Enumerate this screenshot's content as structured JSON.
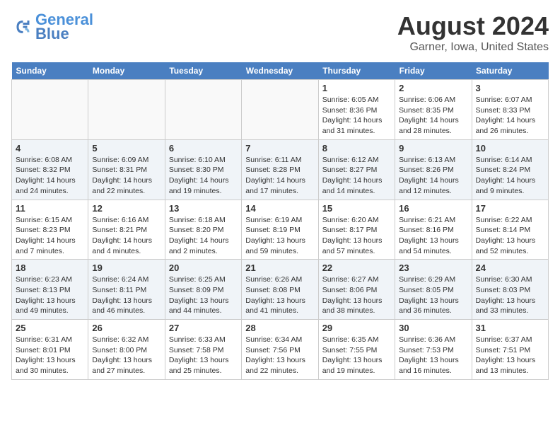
{
  "header": {
    "logo_line1": "General",
    "logo_line2": "Blue",
    "main_title": "August 2024",
    "subtitle": "Garner, Iowa, United States"
  },
  "calendar": {
    "days_of_week": [
      "Sunday",
      "Monday",
      "Tuesday",
      "Wednesday",
      "Thursday",
      "Friday",
      "Saturday"
    ],
    "weeks": [
      [
        {
          "day": "",
          "info": ""
        },
        {
          "day": "",
          "info": ""
        },
        {
          "day": "",
          "info": ""
        },
        {
          "day": "",
          "info": ""
        },
        {
          "day": "1",
          "info": "Sunrise: 6:05 AM\nSunset: 8:36 PM\nDaylight: 14 hours\nand 31 minutes."
        },
        {
          "day": "2",
          "info": "Sunrise: 6:06 AM\nSunset: 8:35 PM\nDaylight: 14 hours\nand 28 minutes."
        },
        {
          "day": "3",
          "info": "Sunrise: 6:07 AM\nSunset: 8:33 PM\nDaylight: 14 hours\nand 26 minutes."
        }
      ],
      [
        {
          "day": "4",
          "info": "Sunrise: 6:08 AM\nSunset: 8:32 PM\nDaylight: 14 hours\nand 24 minutes."
        },
        {
          "day": "5",
          "info": "Sunrise: 6:09 AM\nSunset: 8:31 PM\nDaylight: 14 hours\nand 22 minutes."
        },
        {
          "day": "6",
          "info": "Sunrise: 6:10 AM\nSunset: 8:30 PM\nDaylight: 14 hours\nand 19 minutes."
        },
        {
          "day": "7",
          "info": "Sunrise: 6:11 AM\nSunset: 8:28 PM\nDaylight: 14 hours\nand 17 minutes."
        },
        {
          "day": "8",
          "info": "Sunrise: 6:12 AM\nSunset: 8:27 PM\nDaylight: 14 hours\nand 14 minutes."
        },
        {
          "day": "9",
          "info": "Sunrise: 6:13 AM\nSunset: 8:26 PM\nDaylight: 14 hours\nand 12 minutes."
        },
        {
          "day": "10",
          "info": "Sunrise: 6:14 AM\nSunset: 8:24 PM\nDaylight: 14 hours\nand 9 minutes."
        }
      ],
      [
        {
          "day": "11",
          "info": "Sunrise: 6:15 AM\nSunset: 8:23 PM\nDaylight: 14 hours\nand 7 minutes."
        },
        {
          "day": "12",
          "info": "Sunrise: 6:16 AM\nSunset: 8:21 PM\nDaylight: 14 hours\nand 4 minutes."
        },
        {
          "day": "13",
          "info": "Sunrise: 6:18 AM\nSunset: 8:20 PM\nDaylight: 14 hours\nand 2 minutes."
        },
        {
          "day": "14",
          "info": "Sunrise: 6:19 AM\nSunset: 8:19 PM\nDaylight: 13 hours\nand 59 minutes."
        },
        {
          "day": "15",
          "info": "Sunrise: 6:20 AM\nSunset: 8:17 PM\nDaylight: 13 hours\nand 57 minutes."
        },
        {
          "day": "16",
          "info": "Sunrise: 6:21 AM\nSunset: 8:16 PM\nDaylight: 13 hours\nand 54 minutes."
        },
        {
          "day": "17",
          "info": "Sunrise: 6:22 AM\nSunset: 8:14 PM\nDaylight: 13 hours\nand 52 minutes."
        }
      ],
      [
        {
          "day": "18",
          "info": "Sunrise: 6:23 AM\nSunset: 8:13 PM\nDaylight: 13 hours\nand 49 minutes."
        },
        {
          "day": "19",
          "info": "Sunrise: 6:24 AM\nSunset: 8:11 PM\nDaylight: 13 hours\nand 46 minutes."
        },
        {
          "day": "20",
          "info": "Sunrise: 6:25 AM\nSunset: 8:09 PM\nDaylight: 13 hours\nand 44 minutes."
        },
        {
          "day": "21",
          "info": "Sunrise: 6:26 AM\nSunset: 8:08 PM\nDaylight: 13 hours\nand 41 minutes."
        },
        {
          "day": "22",
          "info": "Sunrise: 6:27 AM\nSunset: 8:06 PM\nDaylight: 13 hours\nand 38 minutes."
        },
        {
          "day": "23",
          "info": "Sunrise: 6:29 AM\nSunset: 8:05 PM\nDaylight: 13 hours\nand 36 minutes."
        },
        {
          "day": "24",
          "info": "Sunrise: 6:30 AM\nSunset: 8:03 PM\nDaylight: 13 hours\nand 33 minutes."
        }
      ],
      [
        {
          "day": "25",
          "info": "Sunrise: 6:31 AM\nSunset: 8:01 PM\nDaylight: 13 hours\nand 30 minutes."
        },
        {
          "day": "26",
          "info": "Sunrise: 6:32 AM\nSunset: 8:00 PM\nDaylight: 13 hours\nand 27 minutes."
        },
        {
          "day": "27",
          "info": "Sunrise: 6:33 AM\nSunset: 7:58 PM\nDaylight: 13 hours\nand 25 minutes."
        },
        {
          "day": "28",
          "info": "Sunrise: 6:34 AM\nSunset: 7:56 PM\nDaylight: 13 hours\nand 22 minutes."
        },
        {
          "day": "29",
          "info": "Sunrise: 6:35 AM\nSunset: 7:55 PM\nDaylight: 13 hours\nand 19 minutes."
        },
        {
          "day": "30",
          "info": "Sunrise: 6:36 AM\nSunset: 7:53 PM\nDaylight: 13 hours\nand 16 minutes."
        },
        {
          "day": "31",
          "info": "Sunrise: 6:37 AM\nSunset: 7:51 PM\nDaylight: 13 hours\nand 13 minutes."
        }
      ]
    ]
  }
}
